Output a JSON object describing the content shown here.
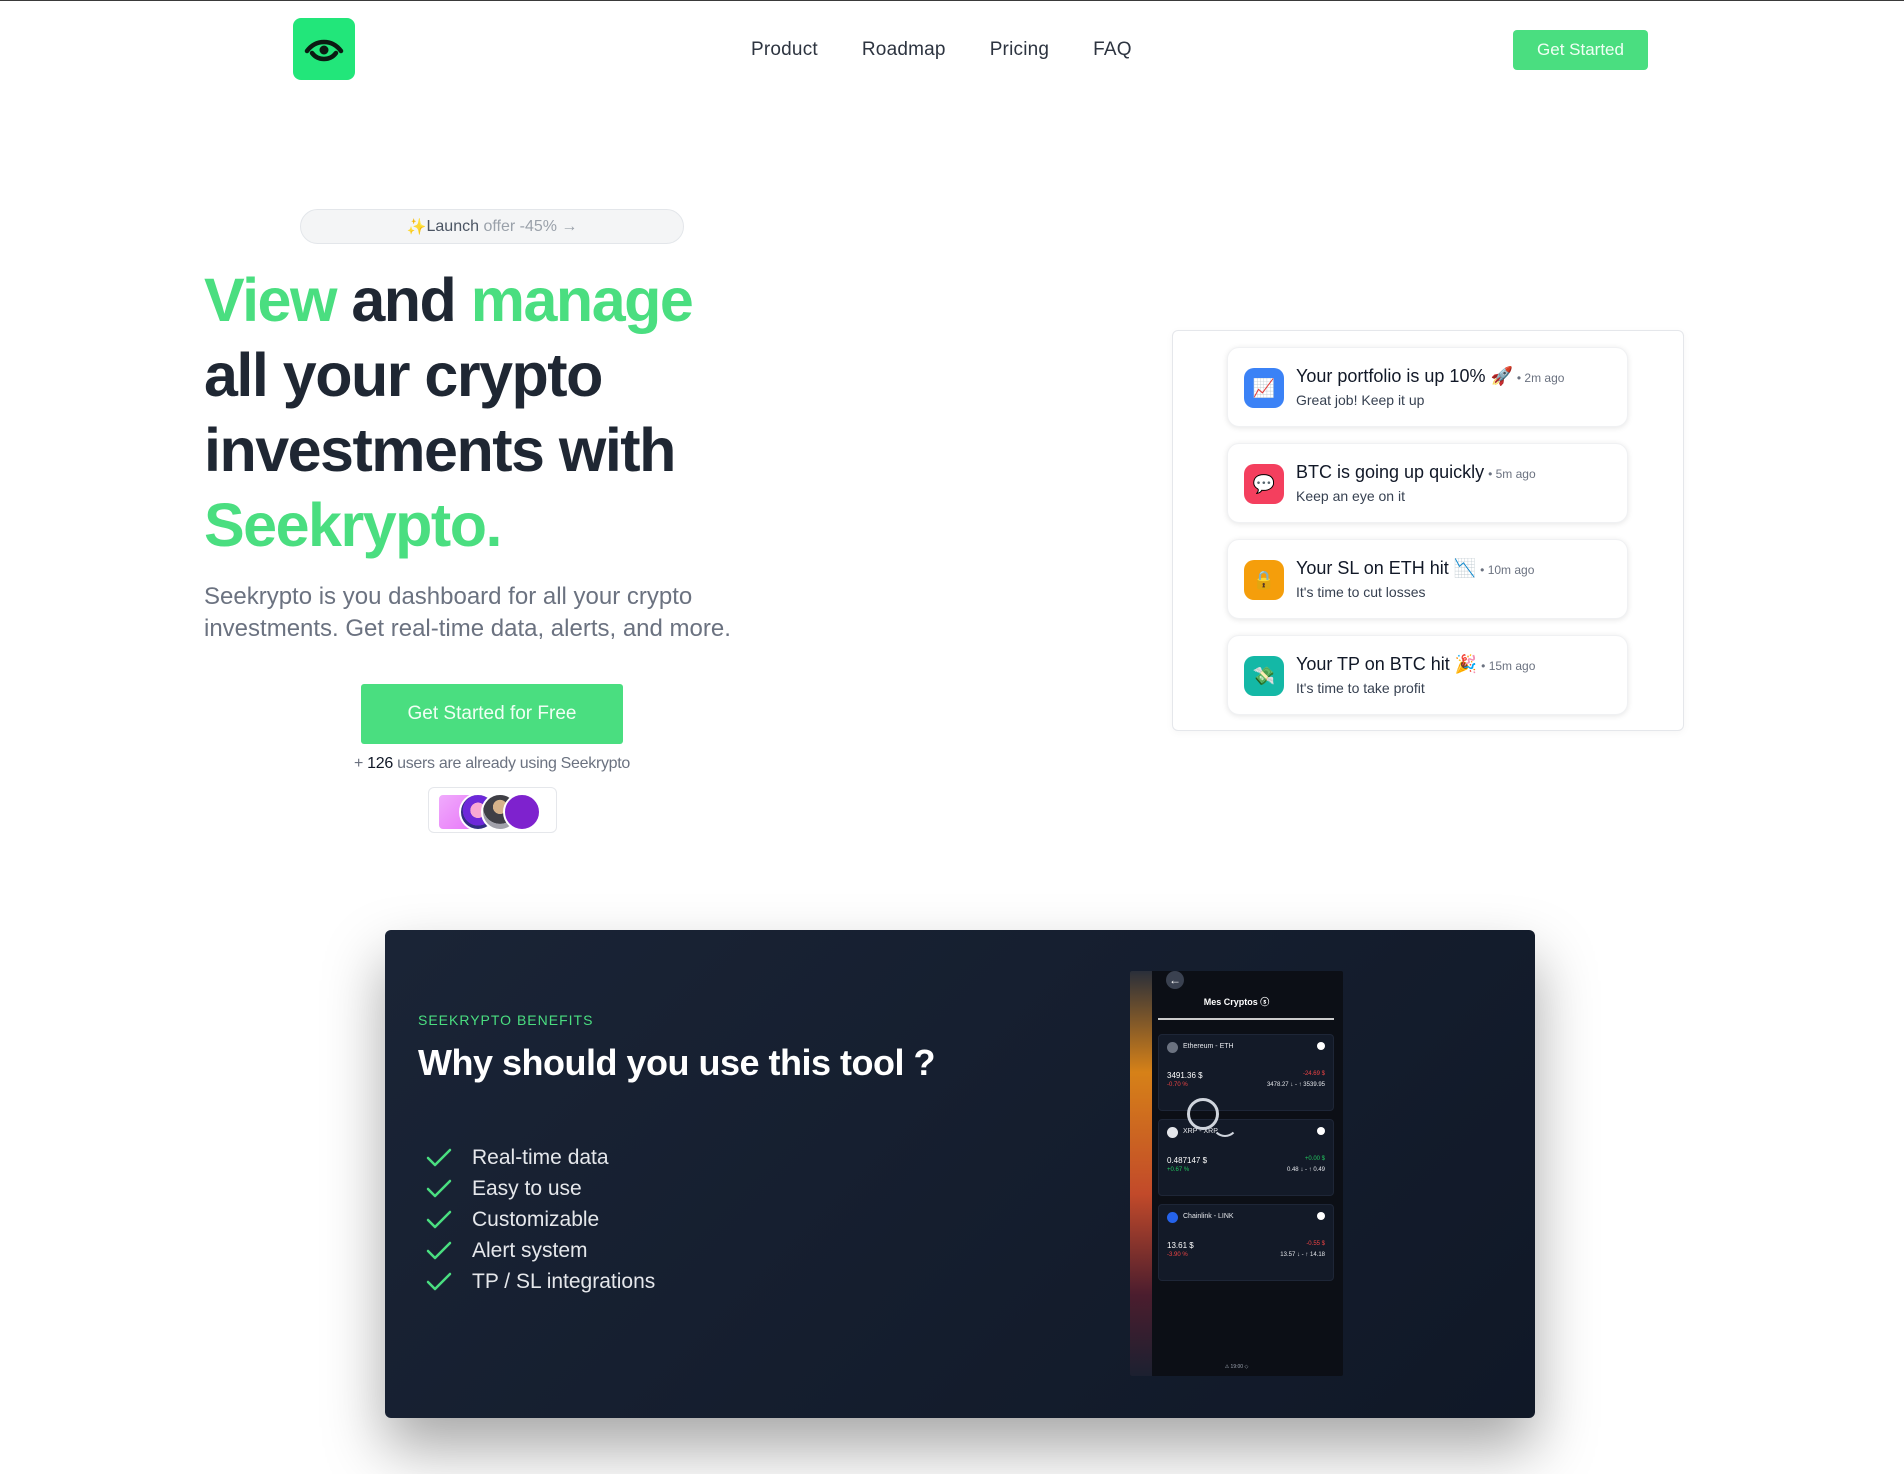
{
  "header": {
    "nav": [
      "Product",
      "Roadmap",
      "Pricing",
      "FAQ"
    ],
    "cta_label": "Get Started",
    "brand_color": "#4ade80",
    "logo_color": "#22e67a"
  },
  "hero": {
    "offer_sparkle": "✨",
    "offer_dark": "Launch",
    "offer_light": "offer -45% →",
    "title": {
      "w1": "View",
      "w2": "and",
      "w3": "manage",
      "line2": "all your crypto",
      "line3": "investments with",
      "brand": "Seekrypto."
    },
    "subtitle": "Seekrypto is you dashboard for all your crypto investments. Get real-time data, alerts, and more.",
    "cta_label": "Get Started for Free",
    "users_prefix": "+",
    "users_count": "126",
    "users_suffix": "users are already using Seekrypto"
  },
  "notifications": [
    {
      "title": "Your portfolio is up 10% 🚀",
      "time": "• 2m ago",
      "subtitle": "Great job! Keep it up",
      "icon": "chart-up-icon",
      "icon_glyph": "📈",
      "icon_color": "#3b82f6"
    },
    {
      "title": "BTC is going up quickly",
      "time": "• 5m ago",
      "subtitle": "Keep an eye on it",
      "icon": "chat-icon",
      "icon_glyph": "💬",
      "icon_color": "#f43f5e"
    },
    {
      "title": "Your SL on ETH hit 📉",
      "time": "• 10m ago",
      "subtitle": "It's time to cut losses",
      "icon": "lock-icon",
      "icon_glyph": "🔒",
      "icon_color": "#f59e0b"
    },
    {
      "title": "Your TP on BTC hit 🎉",
      "time": "• 15m ago",
      "subtitle": "It's time to take profit",
      "icon": "money-icon",
      "icon_glyph": "💸",
      "icon_color": "#14b8a6"
    }
  ],
  "benefits": {
    "kicker": "SEEKRYPTO BENEFITS",
    "title": "Why should you use this tool ?",
    "items": [
      "Real-time data",
      "Easy to use",
      "Customizable",
      "Alert system",
      "TP / SL integrations"
    ]
  },
  "phone": {
    "title": "Mes Cryptos",
    "title_icon": "ⓢ",
    "back": "←",
    "cards": [
      {
        "name": "Ethereum - ETH",
        "price": "3491.36 $",
        "pct": "-0.70 %",
        "change": "-24.69 $",
        "range": "3478.27 ↓ - ↑ 3539.95",
        "dir": "down",
        "dot": "#6b7280"
      },
      {
        "name": "XRP - XRP",
        "price": "0.487147 $",
        "pct": "+0.67 %",
        "change": "+0.00 $",
        "range": "0.48 ↓ - ↑ 0.49",
        "dir": "up",
        "dot": "#e5e7eb"
      },
      {
        "name": "Chainlink - LINK",
        "price": "13.61 $",
        "pct": "-3.90 %",
        "change": "-0.55 $",
        "range": "13.57 ↓ - ↑ 14.18",
        "dir": "down",
        "dot": "#2563eb"
      }
    ],
    "footer": "⚠   19:00   ◇"
  }
}
